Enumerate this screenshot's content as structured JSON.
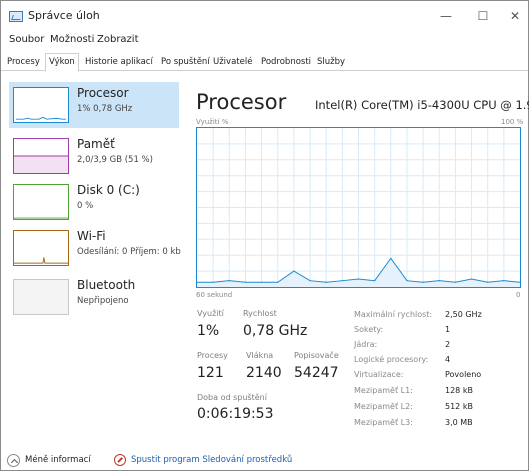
{
  "window": {
    "title": "Správce úloh",
    "buttons": {
      "minimize": "—",
      "maximize": "☐",
      "close": "✕"
    }
  },
  "menu": [
    "Soubor",
    "Možnosti",
    "Zobrazit"
  ],
  "tabs": [
    "Procesy",
    "Výkon",
    "Historie aplikací",
    "Po spuštění",
    "Uživatelé",
    "Podrobnosti",
    "Služby"
  ],
  "active_tab": "Výkon",
  "sidebar": {
    "items": [
      {
        "name": "Procesor",
        "sub": "1% 0,78 GHz",
        "color": "#1d8ad0",
        "selected": true
      },
      {
        "name": "Paměť",
        "sub": "2,0/3,9 GB (51 %)",
        "color": "#9b3fa6",
        "selected": false
      },
      {
        "name": "Disk 0 (C:)",
        "sub": "0 %",
        "color": "#4fa334",
        "selected": false
      },
      {
        "name": "Wi-Fi",
        "sub": "Odesílání: 0 Příjem: 0 kb",
        "color": "#a86a18",
        "selected": false
      },
      {
        "name": "Bluetooth",
        "sub": "Nepřipojeno",
        "color": "#a0a0a0",
        "selected": false
      }
    ]
  },
  "main": {
    "title": "Procesor",
    "model": "Intel(R) Core(TM) i5-4300U CPU @ 1.9...",
    "graph_label_left": "Využití %",
    "graph_label_right": "100 %",
    "graph_bottom_left": "60 sekund",
    "graph_bottom_right": "0"
  },
  "chart_data": {
    "type": "line",
    "title": "Procesor",
    "ylabel": "Využití %",
    "xlabel": "60 sekund",
    "ylim": [
      0,
      100
    ],
    "x": [
      60,
      57,
      54,
      51,
      48,
      45,
      42,
      39,
      36,
      33,
      30,
      27,
      24,
      21,
      18,
      15,
      12,
      9,
      6,
      3,
      0
    ],
    "series": [
      {
        "values": [
          3,
          3,
          4,
          3,
          3,
          3,
          10,
          4,
          3,
          4,
          5,
          4,
          18,
          4,
          3,
          4,
          3,
          5,
          3,
          4,
          3
        ]
      }
    ],
    "grid": true,
    "color": "#1d8ad0"
  },
  "stats": {
    "utilization_label": "Využití",
    "utilization": "1%",
    "speed_label": "Rychlost",
    "speed": "0,78 GHz",
    "processes_label": "Procesy",
    "processes": "121",
    "threads_label": "Vlákna",
    "threads": "2140",
    "handles_label": "Popisovače",
    "handles": "54247",
    "uptime_label": "Doba od spuštění",
    "uptime": "0:06:19:53"
  },
  "details": [
    {
      "key": "Maximální rychlost:",
      "value": "2,50 GHz"
    },
    {
      "key": "Sokety:",
      "value": "1"
    },
    {
      "key": "Jádra:",
      "value": "2"
    },
    {
      "key": "Logické procesory:",
      "value": "4"
    },
    {
      "key": "Virtualizace:",
      "value": "Povoleno"
    },
    {
      "key": "Mezipaměť L1:",
      "value": "128 kB"
    },
    {
      "key": "Mezipaměť L2:",
      "value": "512 kB"
    },
    {
      "key": "Mezipaměť L3:",
      "value": "3,0 MB"
    }
  ],
  "footer": {
    "less_info": "Méně informací",
    "resource_monitor": "Spustit program Sledování prostředků",
    "link_color": "#1a5fb4"
  }
}
